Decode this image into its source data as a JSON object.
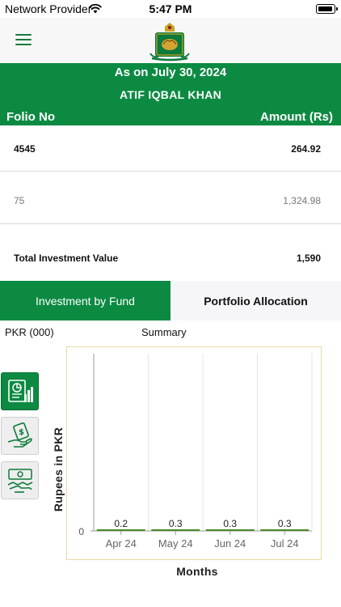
{
  "status_bar": {
    "carrier": "Network Provider",
    "time": "5:47 PM"
  },
  "header": {
    "menu_icon": "hamburger-menu-icon",
    "logo": "crest-logo"
  },
  "summary": {
    "as_on": "As on July 30, 2024",
    "investor_name": "ATIF IQBAL KHAN",
    "col_folio": "Folio No",
    "col_amount": "Amount (Rs)"
  },
  "folios": [
    {
      "folio": "4545",
      "amount": "264.92"
    },
    {
      "folio": "75",
      "amount": "1,324.98"
    }
  ],
  "total": {
    "label": "Total Investment Value",
    "amount": "1,590"
  },
  "tabs": [
    {
      "label": "Investment by Fund",
      "active": true
    },
    {
      "label": "Portfolio Allocation",
      "active": false
    }
  ],
  "chart_header": {
    "unit": "PKR (000)",
    "title": "Summary"
  },
  "side_buttons": [
    {
      "icon": "bar-chart-report-icon",
      "active": true
    },
    {
      "icon": "money-hand-icon",
      "active": false
    },
    {
      "icon": "handshake-money-icon",
      "active": false
    }
  ],
  "colors": {
    "brand_green": "#0c8a42",
    "chart_border": "#ead9a6",
    "bar_green": "#4a8a2a"
  },
  "chart_data": {
    "type": "bar",
    "categories": [
      "Apr 24",
      "May 24",
      "Jun 24",
      "Jul 24"
    ],
    "values": [
      0.2,
      0.3,
      0.3,
      0.3
    ],
    "data_labels": [
      "0.2",
      "0.3",
      "0.3",
      "0.3"
    ],
    "xlabel": "Months",
    "ylabel": "Rupees in PKR",
    "yticks": [
      "0"
    ],
    "grid": true
  }
}
